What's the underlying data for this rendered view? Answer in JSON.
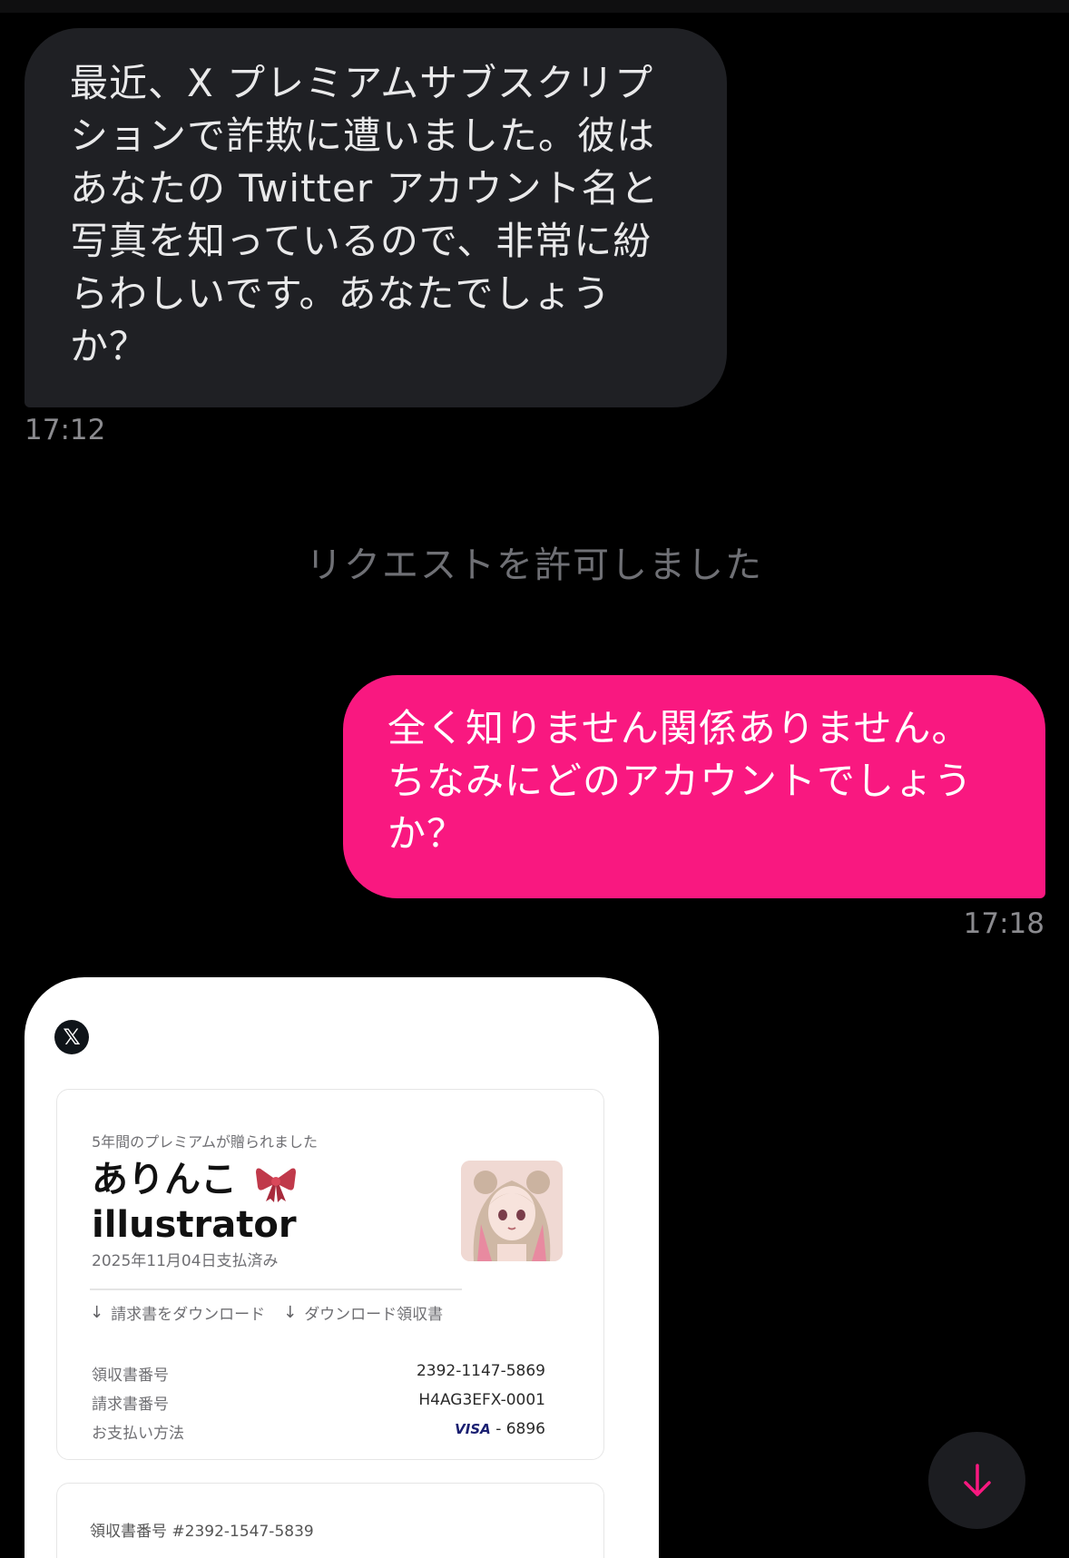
{
  "conversation": {
    "incoming_message": {
      "text": "最近、X プレミアムサブスクリプ\nションで詐欺に遭いました。彼は\nあなたの Twitter アカウント名と\n写真を知っているので、非常に紛\nらわしいです。あなたでしょう\nか？",
      "time": "17:12"
    },
    "system_message": "リクエストを許可しました",
    "outgoing_message": {
      "text": "全く知りません関係ありません。\nちなみにどのアカウントでしょう\nか？",
      "time": "17:18"
    },
    "attachment": {
      "logo": "x-logo-icon",
      "logo_glyph": "𝕏",
      "receipt": {
        "caption": "5年間のプレミアムが贈られました",
        "recipient_name": "ありんこ\nillustrator",
        "paid_date": "2025年11月04日支払済み",
        "actions": [
          {
            "label": "請求書をダウンロード",
            "icon": "download-arrow-icon"
          },
          {
            "label": "ダウンロード領収書",
            "icon": "download-arrow-icon"
          }
        ],
        "details": [
          {
            "key": "領収書番号",
            "value": "2392-1147-5869"
          },
          {
            "key": "請求書番号",
            "value": "H4AG3EFX-0001"
          },
          {
            "key": "お支払い方法",
            "card_brand": "VISA",
            "value": "- 6896"
          }
        ]
      },
      "second_receipt_number": "領収書番号 #2392-1547-5839"
    },
    "scroll_button_icon": "arrow-down-icon"
  },
  "colors": {
    "background": "#000000",
    "incoming_bubble": "#1f2024",
    "outgoing_bubble": "#f91880",
    "accent": "#f91880",
    "timestamp": "#8b8b8f"
  }
}
